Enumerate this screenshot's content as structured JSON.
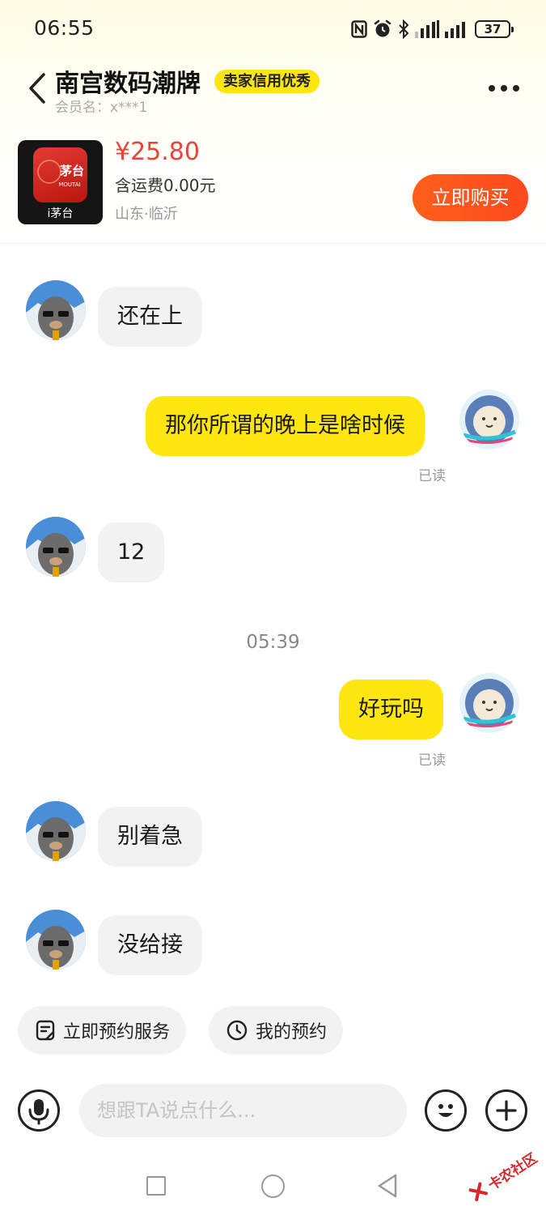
{
  "status_bar": {
    "time": "06:55",
    "battery": "37"
  },
  "header": {
    "shop_name": "南宫数码潮牌",
    "credit_badge": "卖家信用优秀",
    "member_label": "会员名：x***1"
  },
  "product": {
    "brand_label": "i茅台",
    "logo_text": "茅台",
    "logo_sub": "MOUTAI",
    "price": "¥25.80",
    "shipping": "含运费0.00元",
    "location": "山东·临沂",
    "buy_button": "立即购买"
  },
  "messages": [
    {
      "from": "seller",
      "text": "还在上"
    },
    {
      "from": "me",
      "text": "那你所谓的晚上是啥时候",
      "status": "已读"
    },
    {
      "from": "seller",
      "text": "12"
    },
    {
      "from": "system",
      "text": "05:39"
    },
    {
      "from": "me",
      "text": "好玩吗",
      "status": "已读"
    },
    {
      "from": "seller",
      "text": "别着急"
    },
    {
      "from": "seller",
      "text": "没给接"
    }
  ],
  "quick_actions": [
    {
      "label": "立即预约服务",
      "icon": "calendar-note-icon"
    },
    {
      "label": "我的预约",
      "icon": "clock-icon"
    }
  ],
  "input": {
    "placeholder": "想跟TA说点什么..."
  },
  "watermark": "卡农社区",
  "colors": {
    "accent_yellow": "#ffe60f",
    "buy_orange": "#ff5722",
    "price_red": "#e8453a"
  }
}
